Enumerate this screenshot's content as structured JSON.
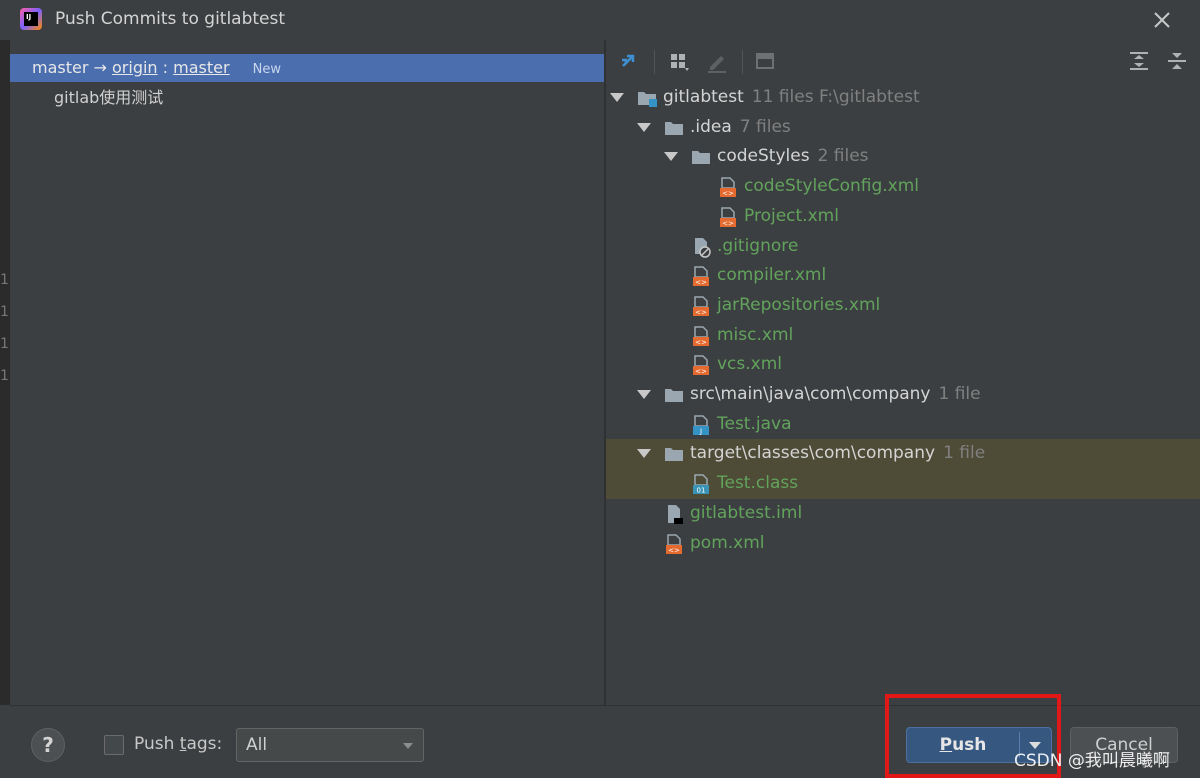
{
  "dialog": {
    "title": "Push Commits to gitlabtest",
    "app_logo_text": "IJ"
  },
  "left_edge_numbers": [
    "1",
    "1",
    "1",
    "1"
  ],
  "branch": {
    "source": "master",
    "arrow": "→",
    "remote": "origin",
    "separator": ":",
    "target": "master",
    "badge": "New"
  },
  "commits": [
    {
      "message": "gitlab使用测试"
    }
  ],
  "toolbar": {
    "icons": [
      "pin-icon",
      "group-by-icon",
      "edit-icon",
      "preview-icon",
      "expand-all-icon",
      "collapse-all-icon"
    ]
  },
  "tree": [
    {
      "name": "gitlabtest",
      "meta": "11 files  F:\\gitlabtest",
      "type": "module",
      "depth": 0,
      "expanded": true
    },
    {
      "name": ".idea",
      "meta": "7 files",
      "type": "dir",
      "depth": 1,
      "expanded": true
    },
    {
      "name": "codeStyles",
      "meta": "2 files",
      "type": "dir",
      "depth": 2,
      "expanded": true
    },
    {
      "name": "codeStyleConfig.xml",
      "meta": "",
      "type": "xml",
      "depth": 3
    },
    {
      "name": "Project.xml",
      "meta": "",
      "type": "xml",
      "depth": 3
    },
    {
      "name": ".gitignore",
      "meta": "",
      "type": "ignore",
      "depth": 2
    },
    {
      "name": "compiler.xml",
      "meta": "",
      "type": "xml",
      "depth": 2
    },
    {
      "name": "jarRepositories.xml",
      "meta": "",
      "type": "xml",
      "depth": 2
    },
    {
      "name": "misc.xml",
      "meta": "",
      "type": "xml",
      "depth": 2
    },
    {
      "name": "vcs.xml",
      "meta": "",
      "type": "xml",
      "depth": 2
    },
    {
      "name": "src\\main\\java\\com\\company",
      "meta": "1 file",
      "type": "dir",
      "depth": 1,
      "expanded": true
    },
    {
      "name": "Test.java",
      "meta": "",
      "type": "java",
      "depth": 2
    },
    {
      "name": "target\\classes\\com\\company",
      "meta": "1 file",
      "type": "dir",
      "depth": 1,
      "expanded": true,
      "highlight": true
    },
    {
      "name": "Test.class",
      "meta": "",
      "type": "class",
      "depth": 2,
      "highlight": true
    },
    {
      "name": "gitlabtest.iml",
      "meta": "",
      "type": "iml",
      "depth": 1
    },
    {
      "name": "pom.xml",
      "meta": "",
      "type": "xml",
      "depth": 1
    }
  ],
  "bottom": {
    "help_label": "?",
    "push_tags_label_pre": "Push ",
    "push_tags_label_mnemonic": "t",
    "push_tags_label_post": "ags:",
    "tags_value": "All",
    "push_label_mnemonic": "P",
    "push_label_rest": "ush",
    "cancel_label": "Cancel"
  },
  "watermark": "CSDN @我叫晨曦啊",
  "colors": {
    "selection": "#4b6eaf",
    "file_added": "#62a35c",
    "highlight_row": "#4e4b36",
    "push_button": "#365880",
    "annotation_box": "#e01818"
  }
}
